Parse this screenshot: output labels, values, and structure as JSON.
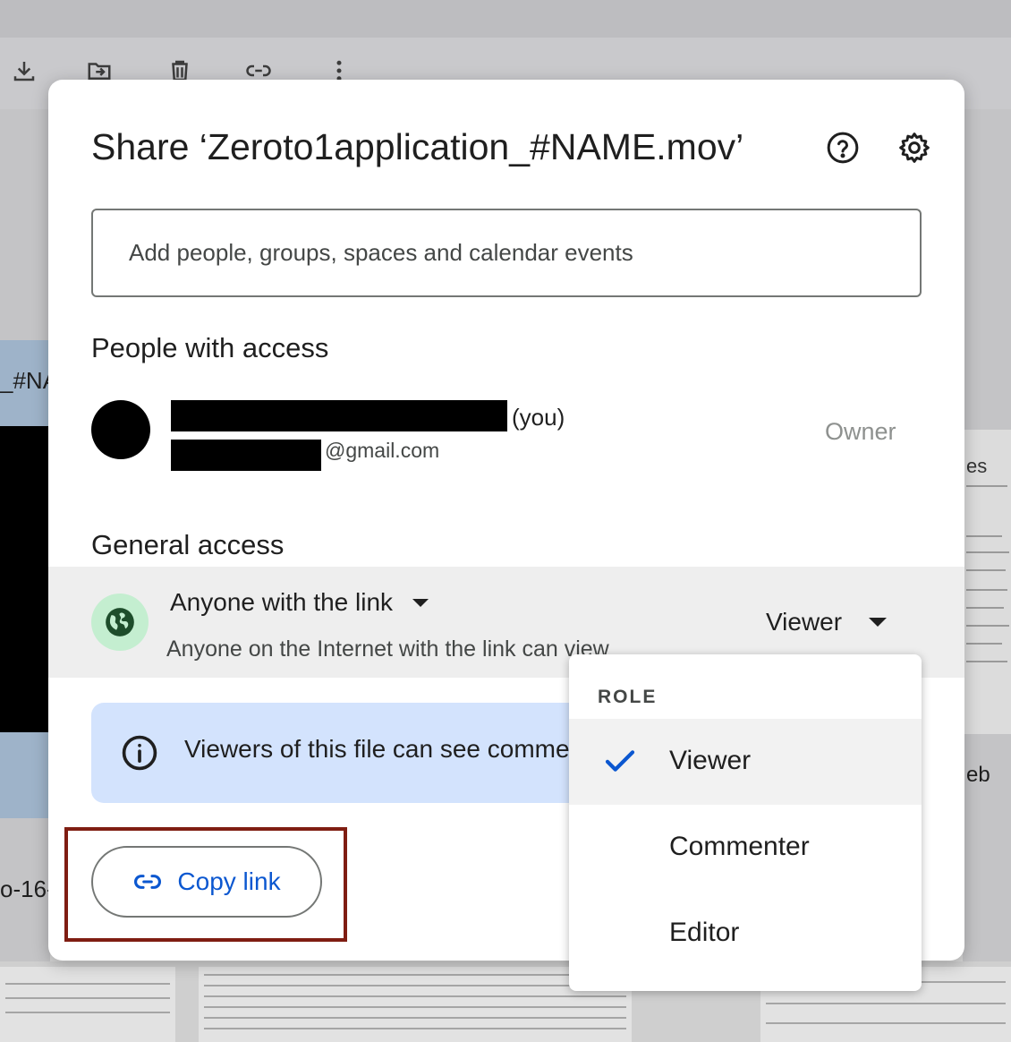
{
  "background": {
    "left_text_top": "_#NA",
    "left_text_bottom": "o-16-",
    "right_text_top": "es",
    "right_text_bottom": "eb"
  },
  "dialog": {
    "title": "Share ‘Zeroto1application_#NAME.mov’",
    "icons": {
      "help": "help-circle-icon",
      "settings": "gear-icon"
    },
    "add_people_placeholder": "Add people, groups, spaces and calendar events",
    "people_heading": "People with access",
    "people": [
      {
        "you_suffix": "(you)",
        "email_suffix": "@gmail.com",
        "role": "Owner"
      }
    ],
    "general_heading": "General access",
    "general_access": {
      "scope": "Anyone with the link",
      "description": "Anyone on the Internet with the link can view",
      "role": "Viewer",
      "icon": "globe-icon",
      "icon_bg_color": "#c4eed0"
    },
    "info_banner": {
      "text": "Viewers of this file can see comme",
      "color": "#d3e3fd"
    },
    "copy_link_label": "Copy link",
    "accent_color": "#0b57d0",
    "highlight_color": "#7f1d12"
  },
  "role_menu": {
    "heading": "ROLE",
    "items": [
      {
        "label": "Viewer",
        "selected": true
      },
      {
        "label": "Commenter",
        "selected": false
      },
      {
        "label": "Editor",
        "selected": false
      }
    ]
  }
}
